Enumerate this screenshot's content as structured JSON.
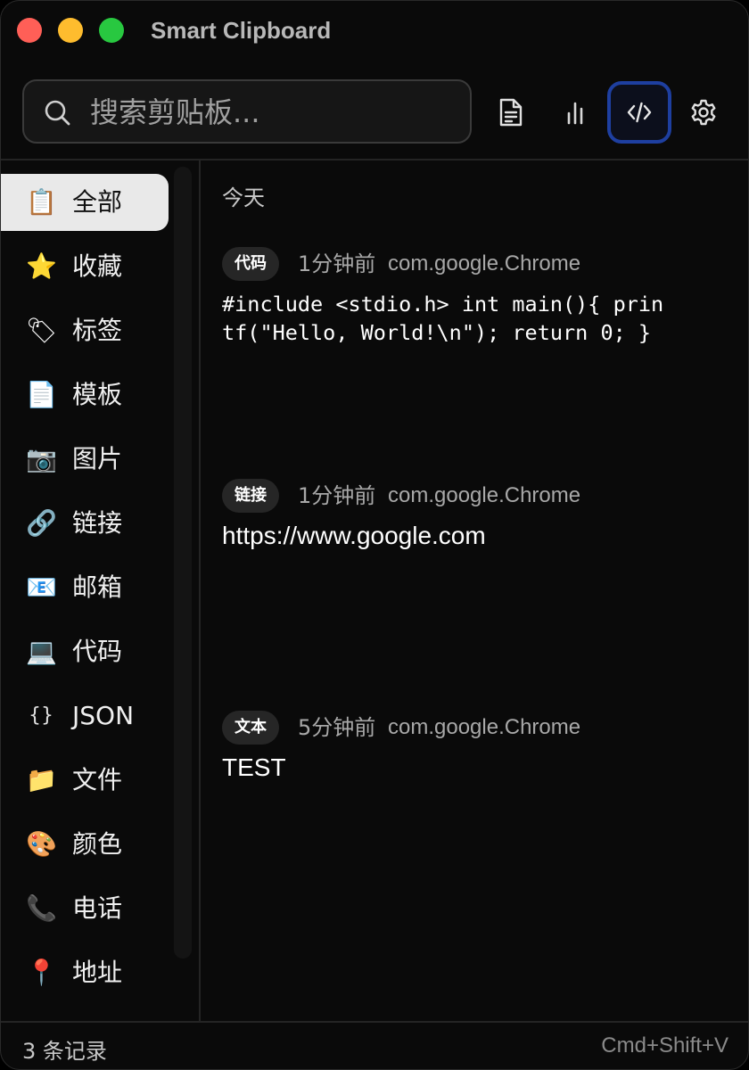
{
  "window": {
    "title": "Smart Clipboard"
  },
  "toolbar": {
    "search_placeholder": "搜索剪贴板...",
    "buttons": [
      {
        "icon": "document-icon"
      },
      {
        "icon": "bar-chart-icon"
      },
      {
        "icon": "code-icon",
        "active": true
      },
      {
        "icon": "gear-icon"
      }
    ]
  },
  "sidebar": {
    "items": [
      {
        "emoji": "📋",
        "label": "全部",
        "active": true
      },
      {
        "emoji": "⭐",
        "label": "收藏"
      },
      {
        "emoji": "🏷",
        "label": "标签"
      },
      {
        "emoji": "📄",
        "label": "模板"
      },
      {
        "emoji": "📷",
        "label": "图片"
      },
      {
        "emoji": "🔗",
        "label": "链接"
      },
      {
        "emoji": "📧",
        "label": "邮箱"
      },
      {
        "emoji": "💻",
        "label": "代码"
      },
      {
        "emoji": "{}",
        "label": "JSON"
      },
      {
        "emoji": "📁",
        "label": "文件"
      },
      {
        "emoji": "🎨",
        "label": "颜色"
      },
      {
        "emoji": "📞",
        "label": "电话"
      },
      {
        "emoji": "📍",
        "label": "地址"
      }
    ]
  },
  "main": {
    "section_title": "今天",
    "entries": [
      {
        "type": "代码",
        "time": "1分钟前",
        "source": "com.google.Chrome",
        "content": "#include <stdio.h> int main(){ printf(\"Hello, World!\\n\"); return 0; }"
      },
      {
        "type": "链接",
        "time": "1分钟前",
        "source": "com.google.Chrome",
        "content": "https://www.google.com"
      },
      {
        "type": "文本",
        "time": "5分钟前",
        "source": "com.google.Chrome",
        "content": "TEST"
      }
    ]
  },
  "footer": {
    "count": "3 条记录",
    "shortcut": "Cmd+Shift+V"
  },
  "colors": {
    "background": "#0a0a0a",
    "active_sidebar": "#e9e9e9",
    "active_button_border": "#1e3fa0",
    "badge": "#262626"
  }
}
